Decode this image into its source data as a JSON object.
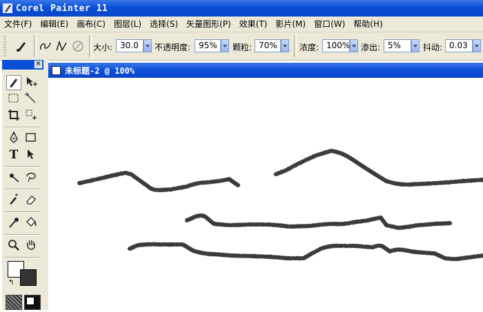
{
  "window": {
    "title": "Corel Painter 11",
    "app_icon": "brush-icon"
  },
  "menu": [
    "文件(F)",
    "编辑(E)",
    "画布(C)",
    "图层(L)",
    "选择(S)",
    "矢量图形(P)",
    "效果(T)",
    "影片(M)",
    "窗口(W)",
    "帮助(H)"
  ],
  "property_bar": {
    "size_label": "大小:",
    "size_value": "30.0",
    "opacity_label": "不透明度:",
    "opacity_value": "95%",
    "grain_label": "颗粒:",
    "grain_value": "70%",
    "concentration_label": "浓度:",
    "concentration_value": "100%",
    "bleed_label": "渗出:",
    "bleed_value": "5%",
    "jitter_label": "抖动:",
    "jitter_value": "0.03"
  },
  "document": {
    "title": "未标题-2 @ 100%"
  },
  "colors": {
    "title_blue": "#0a4fd8",
    "chrome": "#ece9d8",
    "stroke": "#333333",
    "main_color": "#ffffff",
    "secondary_color": "#333333"
  },
  "tools": [
    "brush-icon",
    "move-icon",
    "rect-select-icon",
    "magic-wand-icon",
    "crop-icon",
    "transform-icon",
    "pen-icon",
    "rectangle-icon",
    "text-icon",
    "selection-adjust-icon",
    "dropper-line-icon",
    "lasso-icon",
    "cloner-icon",
    "eraser-icon",
    "eyedropper-icon",
    "paint-bucket-icon",
    "magnifier-icon",
    "grabber-hand-icon"
  ]
}
